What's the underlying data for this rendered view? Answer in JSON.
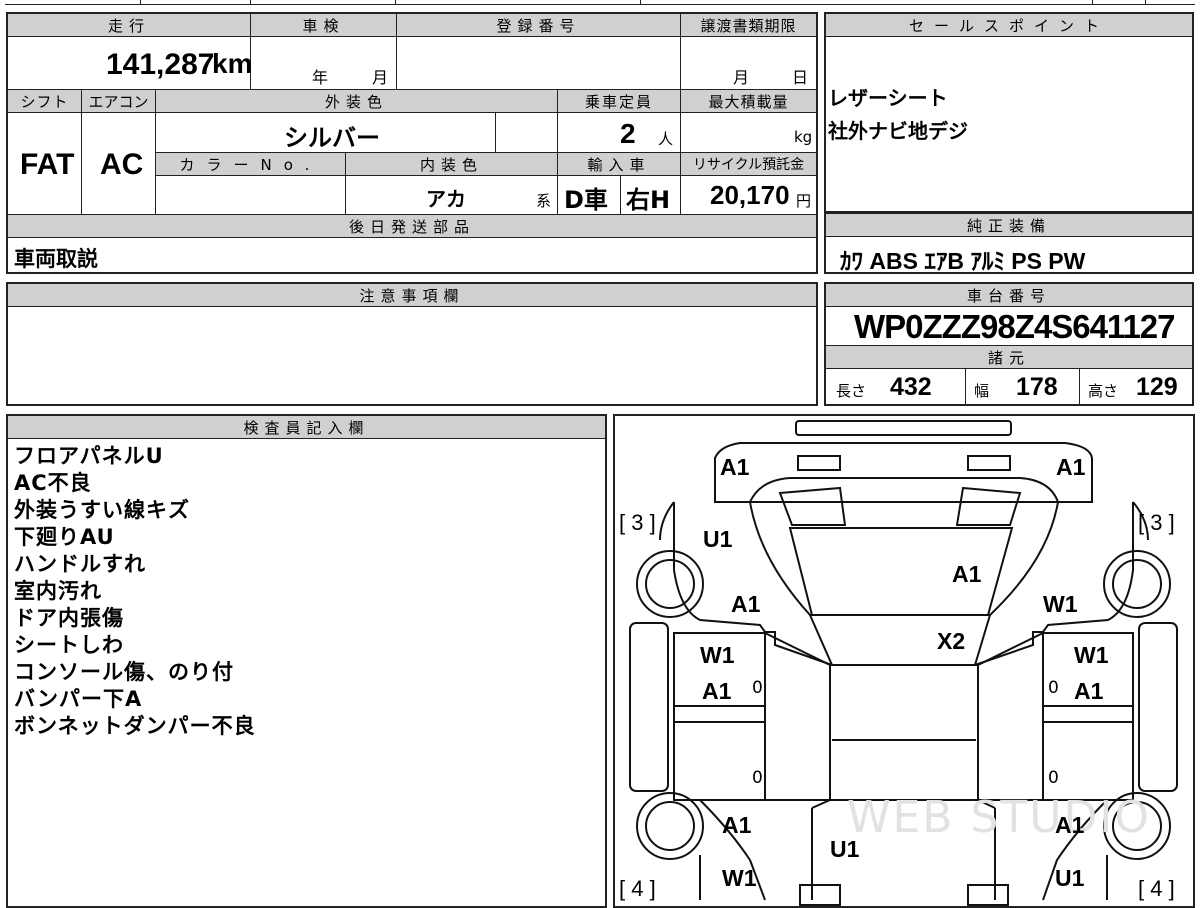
{
  "top": {
    "mileage_label": "走行",
    "mileage_value": "141,287",
    "mileage_unit": "km",
    "shaken_label": "車検",
    "shaken_year": "年",
    "shaken_month": "月",
    "reg_label": "登録番号",
    "transfer_label": "譲渡書類期限",
    "transfer_month": "月",
    "transfer_day": "日",
    "shift_label": "シフト",
    "shift_value": "FAT",
    "ac_label": "エアコン",
    "ac_value": "AC",
    "exterior_label": "外装色",
    "exterior_value": "シルバー",
    "capacity_label": "乗車定員",
    "capacity_value": "2",
    "capacity_unit": "人",
    "maxload_label": "最大積載量",
    "maxload_unit": "kg",
    "colorno_label": "カラーNo.",
    "interior_label": "内装色",
    "interior_value": "アカ",
    "interior_suffix": "系",
    "import_label": "輸入車",
    "import_value_1": "D車",
    "import_value_2": "右H",
    "recycle_label": "リサイクル預託金",
    "recycle_value": "20,170",
    "recycle_unit": "円",
    "parts_label": "後日発送部品",
    "parts_value": "車両取説",
    "notes_label": "注意事項欄"
  },
  "sales": {
    "label": "セールスポイント",
    "lines": [
      "レザーシート",
      "社外ナビ地デジ"
    ]
  },
  "equipment": {
    "label": "純正装備",
    "value": "ｶﾜ ABS ｴｱB ｱﾙﾐ PS PW"
  },
  "chassis": {
    "label": "車台番号",
    "value": "WP0ZZZ98Z4S641127"
  },
  "specs": {
    "label": "諸元",
    "length_label": "長さ",
    "length_value": "432",
    "width_label": "幅",
    "width_value": "178",
    "height_label": "高さ",
    "height_value": "129"
  },
  "inspector": {
    "label": "検査員記入欄",
    "items": [
      "フロアパネルU",
      "AC不良",
      "外装うすい線キズ",
      "下廻りAU",
      "ハンドルすれ",
      "室内汚れ",
      "ドア内張傷",
      "シートしわ",
      "コンソール傷、のり付",
      "バンパー下A",
      "ボンネットダンパー不良"
    ]
  },
  "diagram": {
    "tire_front_left": "3",
    "tire_front_right": "3",
    "tire_rear_left": "4",
    "tire_rear_right": "4",
    "marks": [
      "A1",
      "A1",
      "U1",
      "A1",
      "A1",
      "W1",
      "X2",
      "W1",
      "W1",
      "A1",
      "A1",
      "A1",
      "U1",
      "A1",
      "W1",
      "U1"
    ],
    "zeros": [
      "0",
      "0",
      "0",
      "0"
    ],
    "watermark": "WEB STUDIO"
  }
}
